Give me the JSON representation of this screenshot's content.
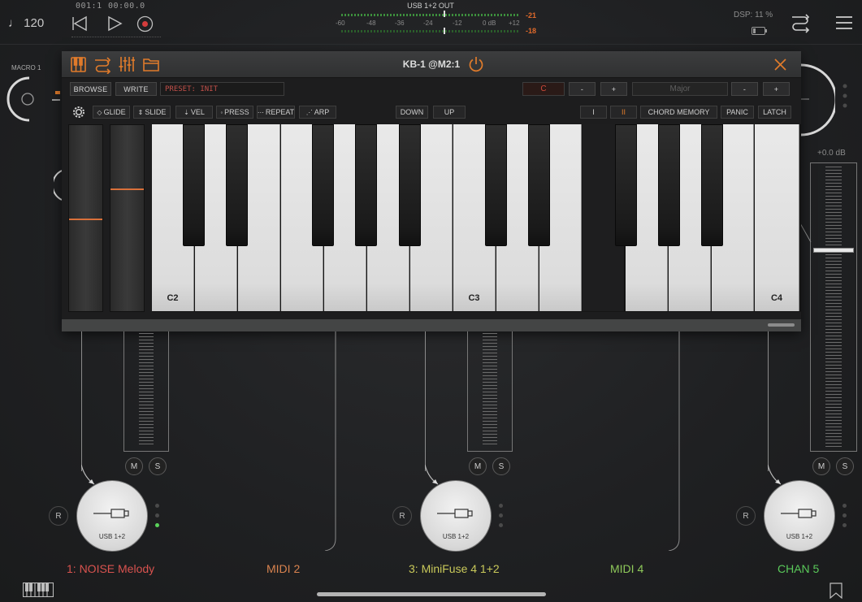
{
  "transport": {
    "tempo": "♩ 120",
    "position_bars": "001:1",
    "position_time": "00:00.0"
  },
  "meter": {
    "title": "USB 1+2 OUT",
    "scale": [
      "-60",
      "-48",
      "-36",
      "-24",
      "-12",
      "0 dB",
      "+12"
    ],
    "peak_top": "-21",
    "peak_bottom": "-18"
  },
  "dsp": "DSP: 11 %",
  "macro_label": "MACRO 1",
  "master": {
    "db": "+0.0 dB"
  },
  "keyboard": {
    "title": "KB-1 @M2:1",
    "browse": "BROWSE",
    "write": "WRITE",
    "preset": "PRESET: INIT",
    "key": "C",
    "key_minus": "-",
    "key_plus": "+",
    "scale": "Major",
    "scale_minus": "-",
    "scale_plus": "+",
    "glide": "GLIDE",
    "slide": "SLIDE",
    "vel": "VEL",
    "press": "PRESS",
    "repeat": "REPEAT",
    "arp": "ARP",
    "down": "DOWN",
    "up": "UP",
    "chord_i": "I",
    "chord_ii": "II",
    "chord_memory": "CHORD MEMORY",
    "panic": "PANIC",
    "latch": "LATCH",
    "white_key_labels": {
      "c2": "C2",
      "c3": "C3",
      "c4": "C4"
    }
  },
  "channels": [
    {
      "name": "1: NOISE Melody",
      "color": "#d9534f",
      "output": "USB 1+2",
      "m": "M",
      "s": "S",
      "r": "R"
    },
    {
      "name": "MIDI 2",
      "color": "#d9834f"
    },
    {
      "name": "3: MiniFuse 4 1+2",
      "color": "#c9c95a",
      "output": "USB 1+2",
      "m": "M",
      "s": "S",
      "r": "R"
    },
    {
      "name": "MIDI 4",
      "color": "#8fc95a"
    },
    {
      "name": "CHAN 5",
      "color": "#5ac95a",
      "output": "USB 1+2",
      "m": "M",
      "s": "S",
      "r": "R"
    }
  ],
  "accent": "#e07b2b"
}
